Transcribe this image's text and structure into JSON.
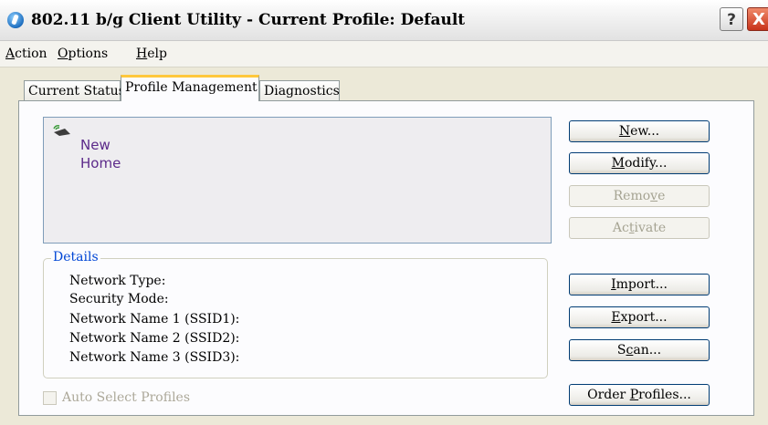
{
  "window": {
    "title": "802.11 b/g Client Utility - Current Profile: Default",
    "help_label": "?",
    "close_label": "X"
  },
  "menu": [
    {
      "accel": "A",
      "rest": "ction"
    },
    {
      "accel": "O",
      "rest": "ptions"
    },
    {
      "accel": "H",
      "rest": "elp"
    }
  ],
  "tabs": [
    {
      "label": "Current Status",
      "active": false
    },
    {
      "label": "Profile Management",
      "active": true
    },
    {
      "label": "Diagnostics",
      "active": false
    }
  ],
  "profiles": [
    "New",
    "Home"
  ],
  "buttons": {
    "new": {
      "accel": "N",
      "rest": "ew..."
    },
    "modify": {
      "accel": "M",
      "rest": "odify..."
    },
    "remove": {
      "pre": "Remo",
      "accel": "v",
      "rest": "e"
    },
    "activate": {
      "pre": "Ac",
      "accel": "t",
      "rest": "ivate"
    },
    "import": {
      "accel": "I",
      "rest": "mport..."
    },
    "export": {
      "accel": "E",
      "rest": "xport..."
    },
    "scan": {
      "pre": "S",
      "accel": "c",
      "rest": "an..."
    },
    "order_profiles": {
      "pre": "Order ",
      "accel": "P",
      "rest": "rofiles..."
    }
  },
  "details": {
    "label": "Details",
    "rows": [
      "Network Type:",
      "Security Mode:",
      "Network Name 1 (SSID1):",
      "Network Name 2 (SSID2):",
      "Network Name 3 (SSID3):"
    ]
  },
  "auto_select": {
    "label": "Auto Select Profiles",
    "checked": false,
    "enabled": false
  }
}
